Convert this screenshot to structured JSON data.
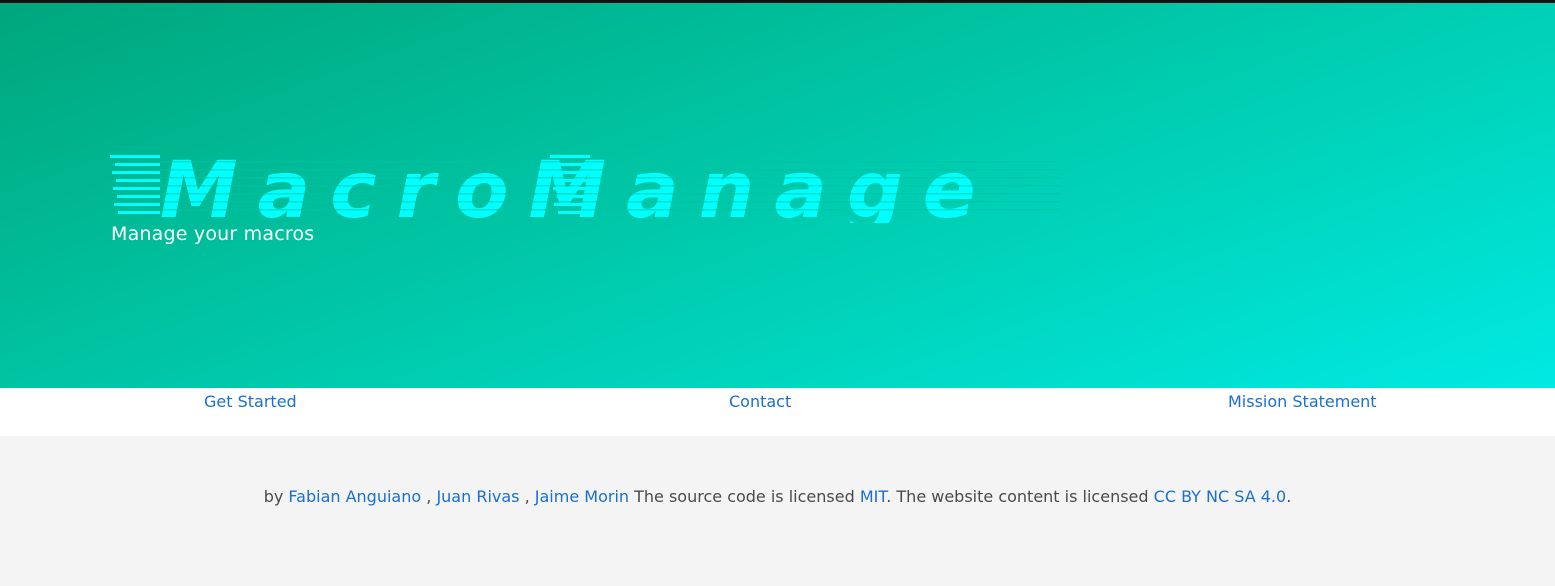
{
  "hero": {
    "logo_text": "MacroManage",
    "tagline": "Manage your macros",
    "colors": {
      "gradient_start": "#00a67c",
      "gradient_end": "#00e9e3",
      "logo": "#00ffff",
      "tagline": "#ffffff"
    }
  },
  "nav": {
    "items": [
      {
        "label": "Get Started"
      },
      {
        "label": "Contact"
      },
      {
        "label": "Mission Statement"
      }
    ],
    "link_color": "#1a6fcf"
  },
  "footer": {
    "prefix": "by",
    "authors": [
      "Fabian Anguiano",
      "Juan Rivas",
      "Jaime Morin"
    ],
    "separator": ",",
    "source_text": "The source code is licensed",
    "source_license": "MIT",
    "content_text": ". The website content is licensed",
    "content_license": "CC BY NC SA 4.0",
    "end": "."
  }
}
